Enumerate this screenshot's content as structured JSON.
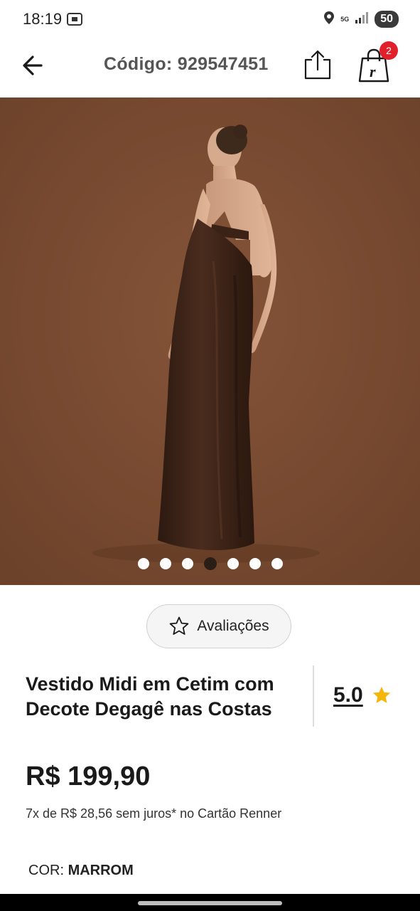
{
  "status_bar": {
    "time": "18:19",
    "network": "5G",
    "battery": "50",
    "icons": [
      "screenshot-icon",
      "location-icon",
      "signal-icon"
    ]
  },
  "header": {
    "title": "Código: 929547451",
    "cart_count": "2",
    "icons": [
      "back-arrow-icon",
      "share-icon",
      "shopping-bag-icon"
    ]
  },
  "gallery": {
    "image_count": 7,
    "active_index": 3
  },
  "reviews_button": {
    "label": "Avaliações"
  },
  "product": {
    "name": "Vestido Midi em Cetim com Decote Degagê nas Costas",
    "rating": "5.0",
    "price": "R$ 199,90",
    "installments": "7x de R$ 28,56 sem juros* no Cartão Renner",
    "color_label": "COR:",
    "color_value": "MARROM"
  },
  "colors": {
    "background_brown": "#7a4c33",
    "dress_brown": "#3b2318",
    "badge_red": "#e0202a",
    "star_yellow": "#f5b50a"
  }
}
